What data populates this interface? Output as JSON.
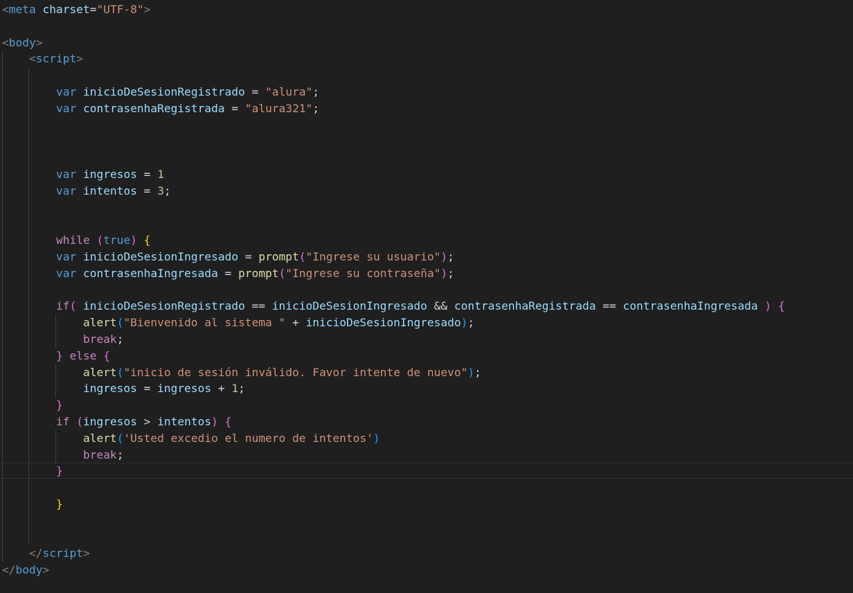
{
  "editor": {
    "background": "#1f1f1f",
    "colors": {
      "tag": "#569cd6",
      "attribute": "#9cdcfe",
      "string": "#ce9178",
      "keyword": "#569cd6",
      "control": "#c586c0",
      "variable": "#9cdcfe",
      "number": "#b5cea8",
      "function": "#dcdcaa",
      "bracket_1": "#ffd700",
      "bracket_2": "#da70d6",
      "bracket_3": "#179fff",
      "text": "#d4d4d4",
      "punctuation": "#808080"
    },
    "lines": [
      [
        [
          "dim",
          "<"
        ],
        [
          "tag",
          "meta"
        ],
        [
          "plain",
          " "
        ],
        [
          "attr",
          "charset"
        ],
        [
          "plain",
          "="
        ],
        [
          "str",
          "\"UTF-8\""
        ],
        [
          "dim",
          ">"
        ]
      ],
      [],
      [
        [
          "dim",
          "<"
        ],
        [
          "tag",
          "body"
        ],
        [
          "dim",
          ">"
        ]
      ],
      [
        [
          "plain",
          "    "
        ],
        [
          "dim",
          "<"
        ],
        [
          "tag",
          "script"
        ],
        [
          "dim",
          ">"
        ]
      ],
      [],
      [
        [
          "plain",
          "        "
        ],
        [
          "kw",
          "var"
        ],
        [
          "plain",
          " "
        ],
        [
          "var",
          "inicioDeSesionRegistrado"
        ],
        [
          "plain",
          " = "
        ],
        [
          "str",
          "\"alura\""
        ],
        [
          "plain",
          ";"
        ]
      ],
      [
        [
          "plain",
          "        "
        ],
        [
          "kw",
          "var"
        ],
        [
          "plain",
          " "
        ],
        [
          "var",
          "contrasenhaRegistrada"
        ],
        [
          "plain",
          " = "
        ],
        [
          "str",
          "\"alura321\""
        ],
        [
          "plain",
          ";"
        ]
      ],
      [],
      [],
      [],
      [
        [
          "plain",
          "        "
        ],
        [
          "kw",
          "var"
        ],
        [
          "plain",
          " "
        ],
        [
          "var",
          "ingresos"
        ],
        [
          "plain",
          " = "
        ],
        [
          "num",
          "1"
        ]
      ],
      [
        [
          "plain",
          "        "
        ],
        [
          "kw",
          "var"
        ],
        [
          "plain",
          " "
        ],
        [
          "var",
          "intentos"
        ],
        [
          "plain",
          " = "
        ],
        [
          "num",
          "3"
        ],
        [
          "plain",
          ";"
        ]
      ],
      [],
      [],
      [
        [
          "plain",
          "        "
        ],
        [
          "ctl",
          "while"
        ],
        [
          "plain",
          " "
        ],
        [
          "p2",
          "("
        ],
        [
          "kw",
          "true"
        ],
        [
          "p2",
          ")"
        ],
        [
          "plain",
          " "
        ],
        [
          "p1",
          "{"
        ]
      ],
      [
        [
          "plain",
          "        "
        ],
        [
          "kw",
          "var"
        ],
        [
          "plain",
          " "
        ],
        [
          "var",
          "inicioDeSesionIngresado"
        ],
        [
          "plain",
          " = "
        ],
        [
          "fn",
          "prompt"
        ],
        [
          "p2",
          "("
        ],
        [
          "str",
          "\"Ingrese su usuario\""
        ],
        [
          "p2",
          ")"
        ],
        [
          "plain",
          ";"
        ]
      ],
      [
        [
          "plain",
          "        "
        ],
        [
          "kw",
          "var"
        ],
        [
          "plain",
          " "
        ],
        [
          "var",
          "contrasenhaIngresada"
        ],
        [
          "plain",
          " = "
        ],
        [
          "fn",
          "prompt"
        ],
        [
          "p2",
          "("
        ],
        [
          "str",
          "\"Ingrese su contraseña\""
        ],
        [
          "p2",
          ")"
        ],
        [
          "plain",
          ";"
        ]
      ],
      [],
      [
        [
          "plain",
          "        "
        ],
        [
          "ctl",
          "if"
        ],
        [
          "p2",
          "("
        ],
        [
          "plain",
          " "
        ],
        [
          "var",
          "inicioDeSesionRegistrado"
        ],
        [
          "plain",
          " == "
        ],
        [
          "var",
          "inicioDeSesionIngresado"
        ],
        [
          "plain",
          " && "
        ],
        [
          "var",
          "contrasenhaRegistrada"
        ],
        [
          "plain",
          " == "
        ],
        [
          "var",
          "contrasenhaIngresada"
        ],
        [
          "plain",
          " "
        ],
        [
          "p2",
          ")"
        ],
        [
          "plain",
          " "
        ],
        [
          "p2",
          "{"
        ]
      ],
      [
        [
          "plain",
          "            "
        ],
        [
          "fn",
          "alert"
        ],
        [
          "p3",
          "("
        ],
        [
          "str",
          "\"Bienvenido al sistema \""
        ],
        [
          "plain",
          " + "
        ],
        [
          "var",
          "inicioDeSesionIngresado"
        ],
        [
          "p3",
          ")"
        ],
        [
          "plain",
          ";"
        ]
      ],
      [
        [
          "plain",
          "            "
        ],
        [
          "ctl",
          "break"
        ],
        [
          "plain",
          ";"
        ]
      ],
      [
        [
          "plain",
          "        "
        ],
        [
          "p2",
          "}"
        ],
        [
          "plain",
          " "
        ],
        [
          "ctl",
          "else"
        ],
        [
          "plain",
          " "
        ],
        [
          "p2",
          "{"
        ]
      ],
      [
        [
          "plain",
          "            "
        ],
        [
          "fn",
          "alert"
        ],
        [
          "p3",
          "("
        ],
        [
          "str",
          "\"inicio de sesión inválido. Favor intente de nuevo\""
        ],
        [
          "p3",
          ")"
        ],
        [
          "plain",
          ";"
        ]
      ],
      [
        [
          "plain",
          "            "
        ],
        [
          "var",
          "ingresos"
        ],
        [
          "plain",
          " = "
        ],
        [
          "var",
          "ingresos"
        ],
        [
          "plain",
          " + "
        ],
        [
          "num",
          "1"
        ],
        [
          "plain",
          ";"
        ]
      ],
      [
        [
          "plain",
          "        "
        ],
        [
          "p2",
          "}"
        ]
      ],
      [
        [
          "plain",
          "        "
        ],
        [
          "ctl",
          "if"
        ],
        [
          "plain",
          " "
        ],
        [
          "p2",
          "("
        ],
        [
          "var",
          "ingresos"
        ],
        [
          "plain",
          " > "
        ],
        [
          "var",
          "intentos"
        ],
        [
          "p2",
          ")"
        ],
        [
          "plain",
          " "
        ],
        [
          "p2",
          "{"
        ]
      ],
      [
        [
          "plain",
          "            "
        ],
        [
          "fn",
          "alert"
        ],
        [
          "p3",
          "("
        ],
        [
          "str",
          "'Usted excedio el numero de intentos'"
        ],
        [
          "p3",
          ")"
        ]
      ],
      [
        [
          "plain",
          "            "
        ],
        [
          "ctl",
          "break"
        ],
        [
          "plain",
          ";"
        ]
      ],
      [
        [
          "plain",
          "        "
        ],
        [
          "p2",
          "}"
        ]
      ],
      [],
      [
        [
          "plain",
          "        "
        ],
        [
          "p1",
          "}"
        ]
      ],
      [],
      [],
      [
        [
          "plain",
          "    "
        ],
        [
          "dim",
          "</"
        ],
        [
          "tag",
          "script"
        ],
        [
          "dim",
          ">"
        ]
      ],
      [
        [
          "dim",
          "</"
        ],
        [
          "tag",
          "body"
        ],
        [
          "dim",
          ">"
        ]
      ]
    ]
  }
}
